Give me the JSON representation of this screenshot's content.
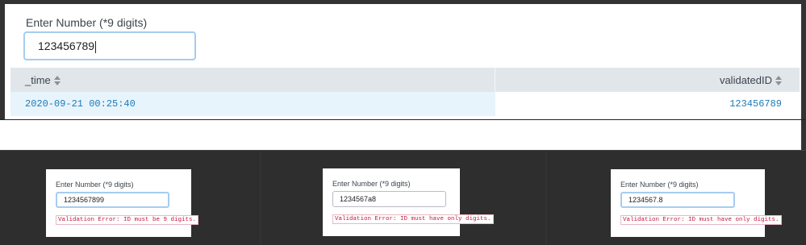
{
  "top": {
    "label": "Enter Number (*9 digits)",
    "input_value": "123456789",
    "table": {
      "columns": [
        "_time",
        "validatedID"
      ],
      "rows": [
        {
          "time": "2020-09-21 00:25:40",
          "validatedID": "123456789"
        }
      ]
    }
  },
  "examples": [
    {
      "label": "Enter Number (*9 digits)",
      "input_value": "1234567899",
      "error": "Validation Error: ID must be 9 digits."
    },
    {
      "label": "Enter Number (*9 digits)",
      "input_value": "1234567a8",
      "error": "Validation Error: ID must have only digits."
    },
    {
      "label": "Enter Number (*9 digits)",
      "input_value": "1234567.8",
      "error": "Validation Error: ID must have only digits."
    }
  ],
  "colors": {
    "accent_focus_border": "#a6ccf0",
    "link_value": "#1a7bb8",
    "error_text": "#c4183c",
    "dark_background": "#333333"
  },
  "icons": {
    "sort": "sort-icon"
  }
}
